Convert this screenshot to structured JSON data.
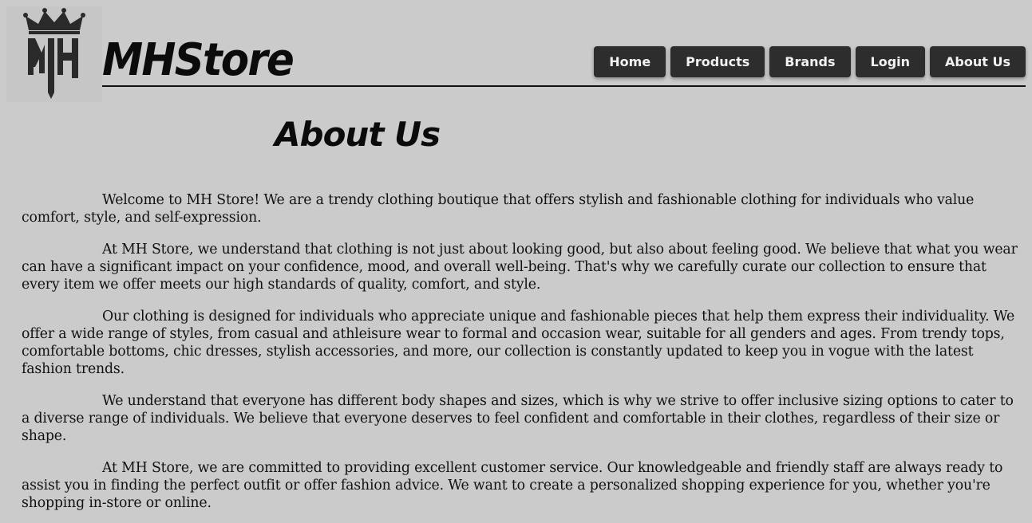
{
  "header": {
    "logo_icon": "crown-mh-logo-icon",
    "logo_text": "MH",
    "brand_name": "MHStore"
  },
  "nav": {
    "items": [
      {
        "label": "Home"
      },
      {
        "label": "Products"
      },
      {
        "label": "Brands"
      },
      {
        "label": "Login"
      },
      {
        "label": "About Us"
      }
    ]
  },
  "main": {
    "title": "About Us",
    "paragraphs": [
      "Welcome to MH Store! We are a trendy clothing boutique that offers stylish and fashionable clothing for individuals who value comfort, style, and self-expression.",
      "At MH Store, we understand that clothing is not just about looking good, but also about feeling good. We believe that what you wear can have a significant impact on your confidence, mood, and overall well-being. That's why we carefully curate our collection to ensure that every item we offer meets our high standards of quality, comfort, and style.",
      "Our clothing is designed for individuals who appreciate unique and fashionable pieces that help them express their individuality. We offer a wide range of styles, from casual and athleisure wear to formal and occasion wear, suitable for all genders and ages. From trendy tops, comfortable bottoms, chic dresses, stylish accessories, and more, our collection is constantly updated to keep you in vogue with the latest fashion trends.",
      "We understand that everyone has different body shapes and sizes, which is why we strive to offer inclusive sizing options to cater to a diverse range of individuals. We believe that everyone deserves to feel confident and comfortable in their clothes, regardless of their size or shape.",
      "At MH Store, we are committed to providing excellent customer service. Our knowledgeable and friendly staff are always ready to assist you in finding the perfect outfit or offer fashion advice. We want to create a personalized shopping experience for you, whether you're shopping in-store or online."
    ]
  },
  "colors": {
    "background": "#cbcbcb",
    "nav_button": "#2d2d2d",
    "nav_text": "#f2f2f2",
    "logo": "#2a2a2a"
  }
}
